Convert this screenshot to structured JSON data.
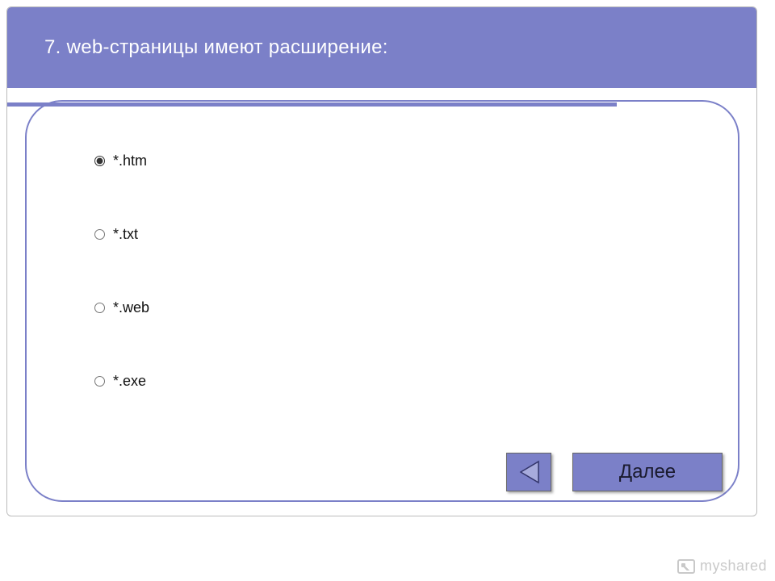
{
  "question": {
    "number": "7.",
    "text": "web-страницы имеют расширение:",
    "full_title": "7. web-страницы имеют расширение:"
  },
  "options": [
    {
      "label": "*.htm",
      "selected": true
    },
    {
      "label": "*.txt",
      "selected": false
    },
    {
      "label": "*.web",
      "selected": false
    },
    {
      "label": "*.exe",
      "selected": false
    }
  ],
  "nav": {
    "next_label": "Далее"
  },
  "watermark": {
    "text": "myshared"
  },
  "colors": {
    "accent": "#7b80c8",
    "text_light": "#ffffff"
  }
}
